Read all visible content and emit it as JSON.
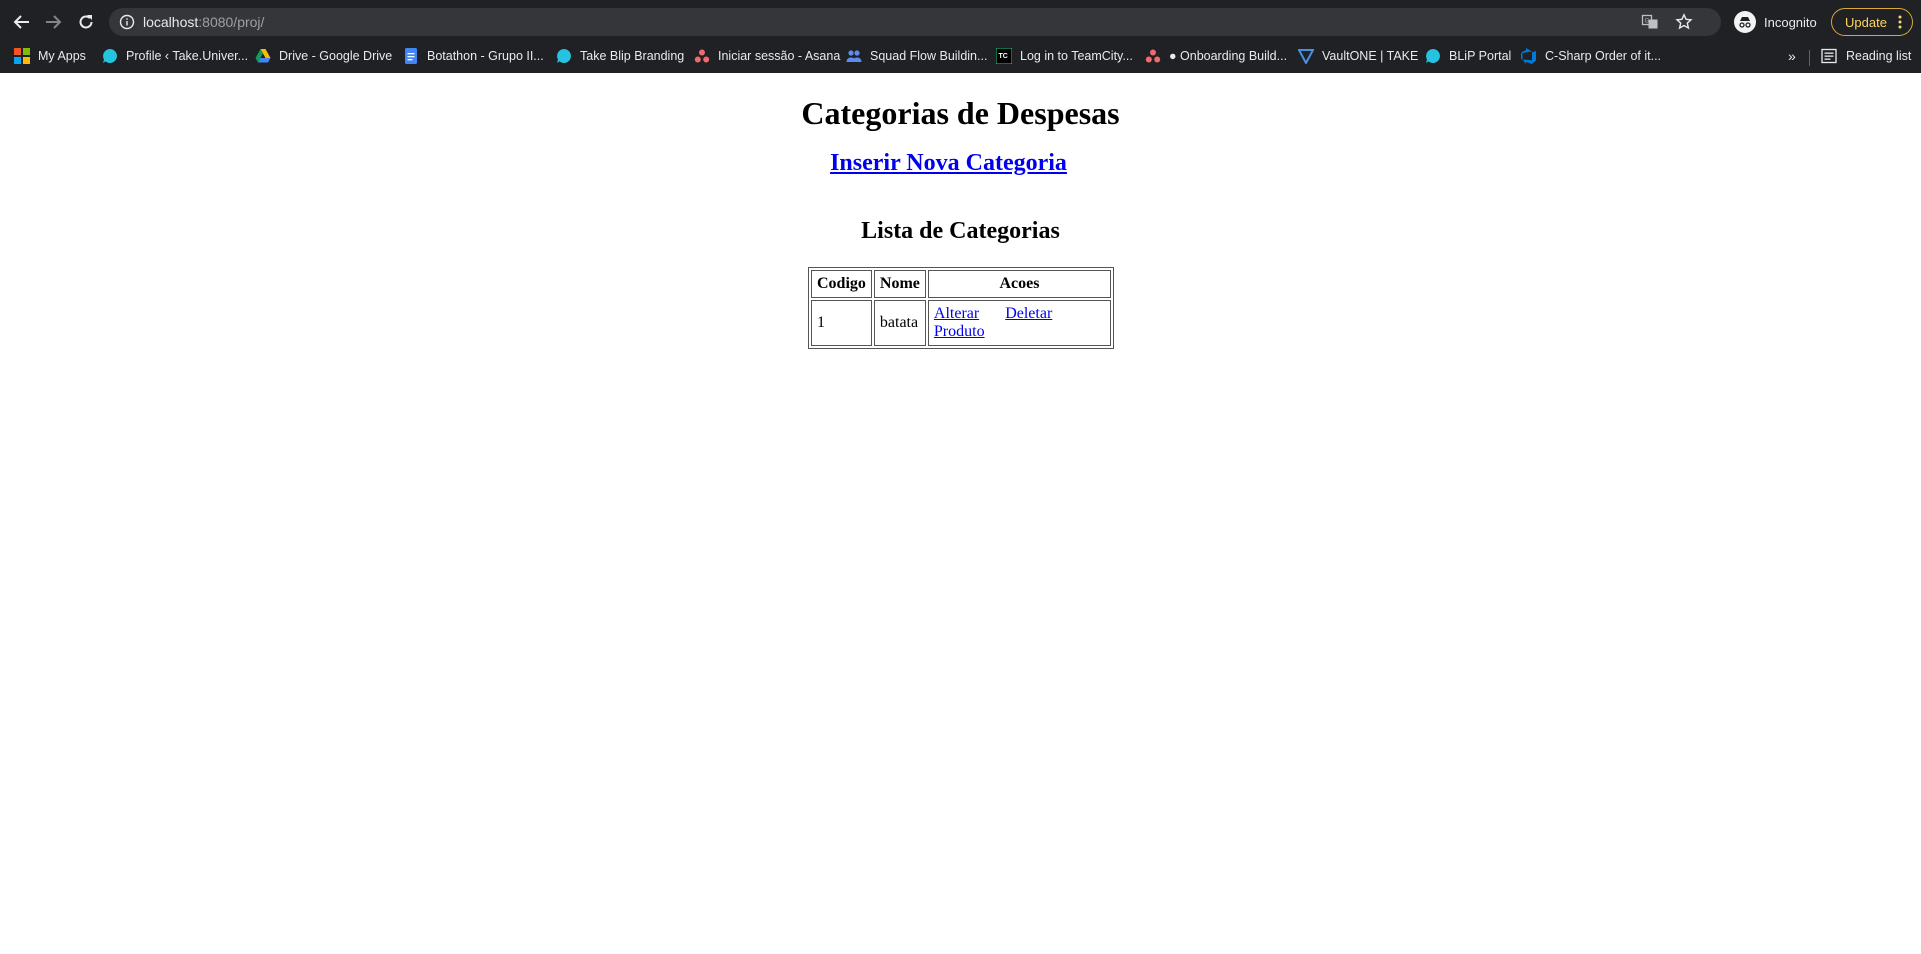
{
  "browser": {
    "url_host": "localhost",
    "url_rest": ":8080/proj/",
    "incognito_label": "Incognito",
    "update_label": "Update",
    "bookmarks": [
      {
        "label": "My Apps",
        "icon": "apps-grid-icon"
      },
      {
        "label": "Profile ‹ Take.Univer...",
        "icon": "blip-icon"
      },
      {
        "label": "Drive - Google Drive",
        "icon": "google-drive-icon"
      },
      {
        "label": "Botathon - Grupo II...",
        "icon": "google-docs-icon"
      },
      {
        "label": "Take Blip Branding",
        "icon": "blip-icon"
      },
      {
        "label": "Iniciar sessão - Asana",
        "icon": "asana-icon"
      },
      {
        "label": "Squad Flow Buildin...",
        "icon": "people-icon"
      },
      {
        "label": "Log in to TeamCity...",
        "icon": "teamcity-icon"
      },
      {
        "label": "● Onboarding Build...",
        "icon": "asana-icon"
      },
      {
        "label": "VaultONE | TAKE",
        "icon": "vaultone-icon"
      },
      {
        "label": "BLiP Portal",
        "icon": "blip-icon"
      },
      {
        "label": "C-Sharp Order of it...",
        "icon": "azure-devops-icon"
      }
    ],
    "more_label": "»",
    "reading_list_label": "Reading list"
  },
  "page": {
    "title": "Categorias de Despesas",
    "new_category_link": "Inserir Nova Categoria",
    "list_title": "Lista de Categorias",
    "table": {
      "headers": [
        "Codigo",
        "Nome",
        "Acoes"
      ],
      "rows": [
        {
          "codigo": "1",
          "nome": "batata",
          "actions": [
            "Alterar",
            "Deletar",
            "Produto"
          ]
        }
      ]
    }
  },
  "colors": {
    "chrome_bg": "#202124",
    "omnibox_bg": "#35363a",
    "link": "#0000ee",
    "update_accent": "#fdd663"
  }
}
